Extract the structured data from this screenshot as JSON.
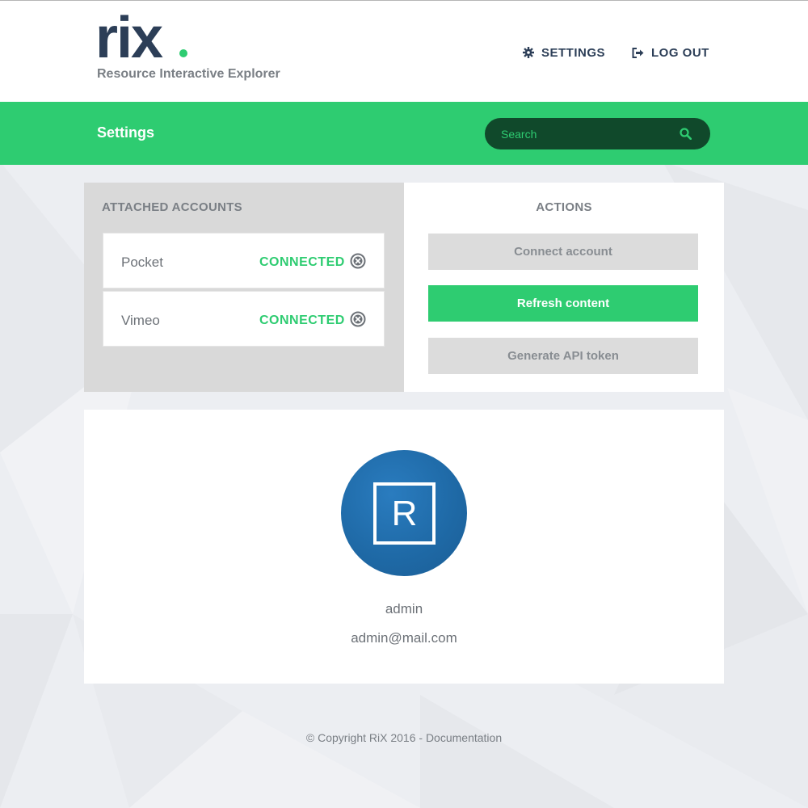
{
  "brand": {
    "logo_text": "rix",
    "tagline": "Resource Interactive Explorer",
    "accent_color": "#2ecc71",
    "dark_color": "#2c3e57"
  },
  "nav": {
    "settings_label": "SETTINGS",
    "settings_icon": "gear-icon",
    "logout_label": "LOG OUT",
    "logout_icon": "logout-icon"
  },
  "page": {
    "title": "Settings"
  },
  "search": {
    "placeholder": "Search",
    "icon": "search-icon"
  },
  "accounts": {
    "heading": "ATTACHED ACCOUNTS",
    "items": [
      {
        "name": "Pocket",
        "status": "CONNECTED",
        "remove_icon": "remove-circle-icon"
      },
      {
        "name": "Vimeo",
        "status": "CONNECTED",
        "remove_icon": "remove-circle-icon"
      }
    ]
  },
  "actions": {
    "heading": "ACTIONS",
    "connect_label": "Connect account",
    "refresh_label": "Refresh content",
    "token_label": "Generate API token"
  },
  "profile": {
    "avatar_letter": "R",
    "avatar_color": "#1f6aa7",
    "username": "admin",
    "email": "admin@mail.com"
  },
  "footer": {
    "copyright": "© Copyright RiX 2016 - ",
    "docs_link": "Documentation"
  }
}
